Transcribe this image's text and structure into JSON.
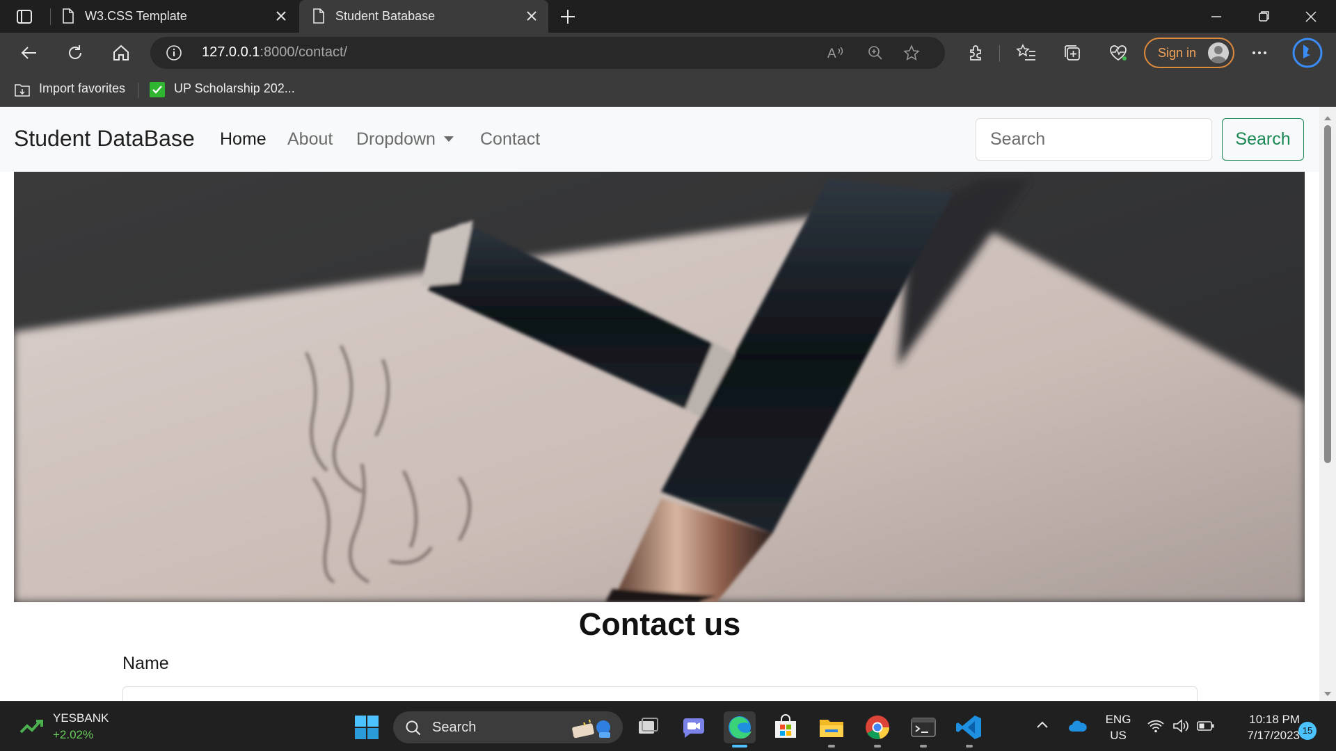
{
  "browser": {
    "tabs": [
      {
        "title": "W3.CSS Template",
        "active": false
      },
      {
        "title": "Student Batabase",
        "active": true
      }
    ],
    "address": {
      "host": "127.0.0.1",
      "path": ":8000/contact/"
    },
    "sign_in_label": "Sign in",
    "favorites": [
      {
        "label": "Import favorites",
        "icon": "import-favorites-icon"
      },
      {
        "label": "UP Scholarship 202...",
        "icon": "green-check-icon"
      }
    ]
  },
  "site": {
    "brand": "Student DataBase",
    "nav": [
      "Home",
      "About",
      "Dropdown",
      "Contact"
    ],
    "search_placeholder": "Search",
    "search_button": "Search",
    "hero_icon": "fountain-pen-photo",
    "contact_title": "Contact us",
    "name_label": "Name"
  },
  "taskbar": {
    "stock": {
      "symbol": "YESBANK",
      "change": "+2.02%"
    },
    "search_label": "Search",
    "apps": [
      "start-icon",
      "task-view-icon",
      "teams-chat-icon",
      "edge-icon",
      "store-icon",
      "file-explorer-icon",
      "chrome-icon",
      "terminal-icon",
      "vscode-icon"
    ],
    "lang": {
      "line1": "ENG",
      "line2": "US"
    },
    "time": "10:18 PM",
    "date": "7/17/2023",
    "notification_count": "15"
  },
  "colors": {
    "accent_green": "#198754",
    "signin_orange": "#e08a3c",
    "edge_blue": "#4cc2ff"
  }
}
